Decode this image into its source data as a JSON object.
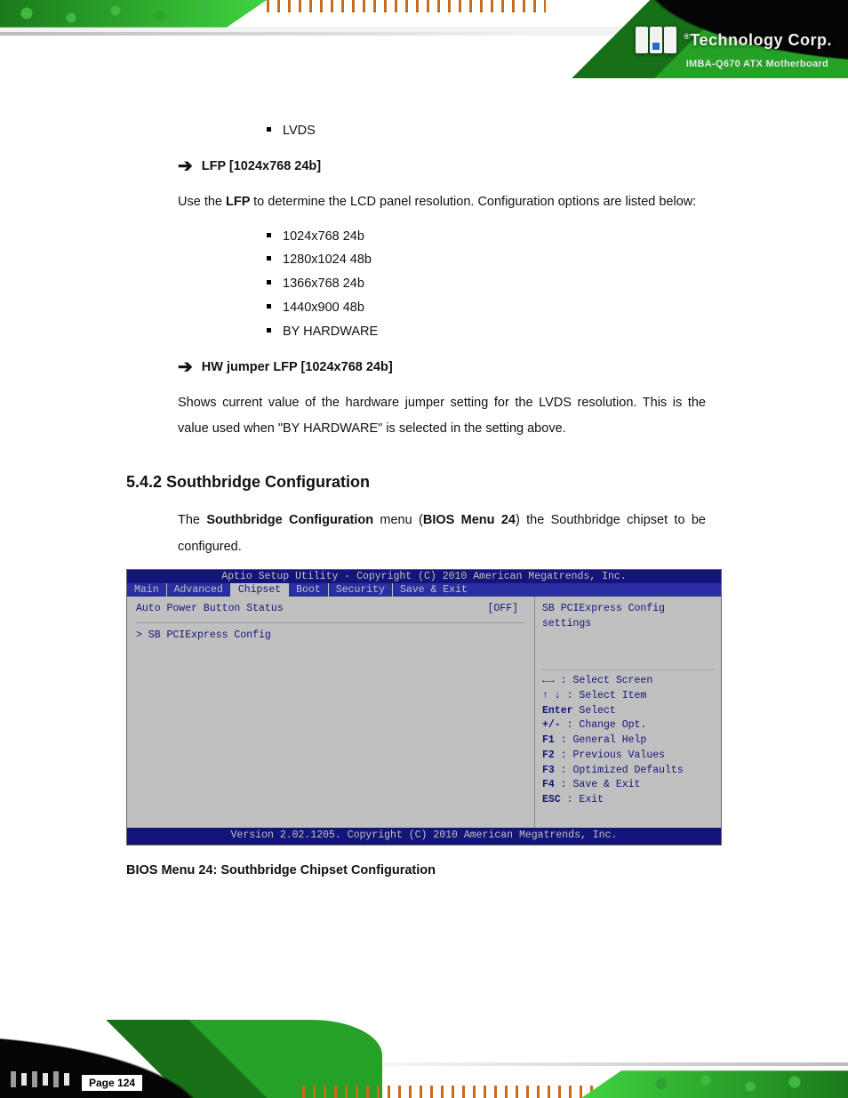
{
  "brand": {
    "prefix": "®",
    "name": "Technology Corp.",
    "product_line": "IMBA-Q670 ATX Motherboard"
  },
  "content": {
    "first_bullet": "LVDS",
    "lfp_heading": "LFP [1024x768 24b]",
    "lfp_para_a": "Use the ",
    "lfp_para_b": "LFP ",
    "lfp_para_c": "to determine the LCD panel resolution. Configuration options are listed below:",
    "lfp_options": [
      "1024x768 24b",
      "1280x1024 48b",
      "1366x768 24b",
      "1440x900 48b",
      "BY HARDWARE"
    ],
    "hw_jumper_heading": "HW jumper LFP [1024x768 24b]",
    "hw_jumper_para": "Shows current value of the hardware jumper setting for the LVDS resolution. This is the value used when \"BY HARDWARE\" is selected in the setting above.",
    "section_head": "5.4.2 Southbridge Configuration",
    "sb_para_a": "The ",
    "sb_para_b": "Southbridge Configuration",
    "sb_para_c": " menu (",
    "sb_para_ref": "BIOS Menu 24",
    "sb_para_d": ") the Southbridge chipset to be configured."
  },
  "bios": {
    "title": "Aptio Setup Utility - Copyright (C) 2010 American Megatrends, Inc.",
    "menus": [
      "Main",
      "Advanced",
      "Chipset",
      "Boot",
      "Security",
      "Save & Exit"
    ],
    "active_index": 2,
    "left_row_label": "Auto Power Button Status",
    "left_row_value": "[OFF]",
    "submenu": "> SB PCIExpress Config",
    "help_desc": "SB PCIExpress Config settings",
    "nav": [
      {
        "k": "←→",
        "t": ": Select Screen"
      },
      {
        "k": "↑ ↓",
        "t": ": Select Item"
      },
      {
        "k": "Enter",
        "t": "Select"
      },
      {
        "k": "+/-",
        "t": ": Change Opt."
      },
      {
        "k": "F1",
        "t": ": General Help"
      },
      {
        "k": "F2",
        "t": ": Previous Values"
      },
      {
        "k": "F3",
        "t": ": Optimized Defaults"
      },
      {
        "k": "F4",
        "t": ": Save & Exit"
      },
      {
        "k": "ESC",
        "t": ": Exit"
      }
    ],
    "footer": "Version 2.02.1205. Copyright (C) 2010 American Megatrends, Inc.",
    "caption": "BIOS Menu 24: Southbridge Chipset Configuration"
  },
  "page": {
    "label": "Page 124"
  }
}
